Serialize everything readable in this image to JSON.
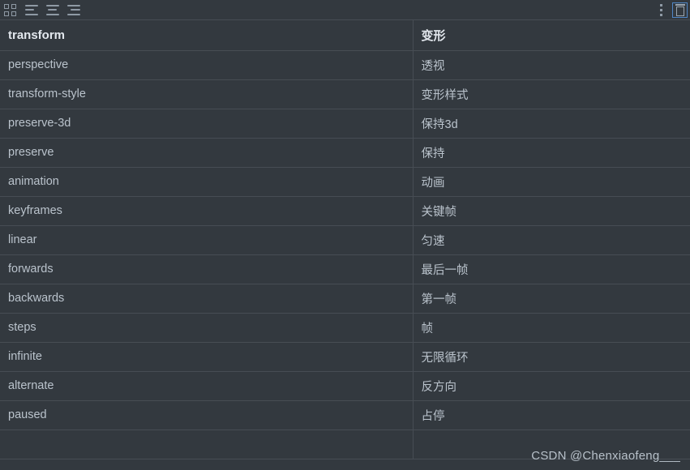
{
  "toolbar": {
    "left_buttons": [
      {
        "name": "table-grid-icon",
        "label": "Table"
      },
      {
        "name": "align-left-icon",
        "label": "Align left"
      },
      {
        "name": "align-center-icon",
        "label": "Align center"
      },
      {
        "name": "align-right-icon",
        "label": "Align right"
      }
    ],
    "right_buttons": [
      {
        "name": "more-options-icon",
        "label": "More options"
      },
      {
        "name": "delete-icon",
        "label": "Delete",
        "selected": true
      }
    ]
  },
  "table": {
    "headers": {
      "en": "transform",
      "zh": "变形"
    },
    "rows": [
      {
        "en": "perspective",
        "zh": "透视"
      },
      {
        "en": "transform-style",
        "zh": "变形样式"
      },
      {
        "en": "preserve-3d",
        "zh": "保持3d"
      },
      {
        "en": "preserve",
        "zh": "保持"
      },
      {
        "en": "animation",
        "zh": "动画"
      },
      {
        "en": "keyframes",
        "zh": "关键帧"
      },
      {
        "en": "linear",
        "zh": "匀速"
      },
      {
        "en": "forwards",
        "zh": "最后一帧"
      },
      {
        "en": "backwards",
        "zh": "第一帧"
      },
      {
        "en": "steps",
        "zh": "帧"
      },
      {
        "en": "infinite",
        "zh": "无限循环"
      },
      {
        "en": "alternate",
        "zh": "反方向"
      },
      {
        "en": "paused",
        "zh": "占停"
      },
      {
        "en": "",
        "zh": ""
      }
    ]
  },
  "watermark": {
    "text": "CSDN @Chenxiaofeng___"
  },
  "colors": {
    "background": "#33393f",
    "border": "#474d54",
    "text": "#bac3cc",
    "heading_text": "#e3e8ee",
    "icon": "#8f9aa5",
    "selection": "#4f86c6"
  }
}
